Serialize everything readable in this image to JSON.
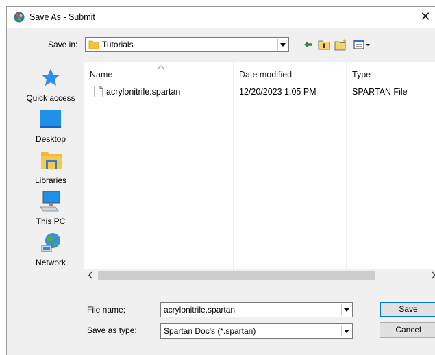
{
  "window": {
    "title": "Save As - Submit",
    "close_symbol": "✕"
  },
  "toolbar": {
    "save_in_label": "Save in:",
    "save_in_value": "Tutorials"
  },
  "places": [
    {
      "label": "Quick access",
      "icon": "quick-access-icon"
    },
    {
      "label": "Desktop",
      "icon": "desktop-icon"
    },
    {
      "label": "Libraries",
      "icon": "libraries-icon"
    },
    {
      "label": "This PC",
      "icon": "this-pc-icon"
    },
    {
      "label": "Network",
      "icon": "network-icon"
    }
  ],
  "filelist": {
    "columns": [
      "Name",
      "Date modified",
      "Type"
    ],
    "rows": [
      {
        "name": "acrylonitrile.spartan",
        "date": "12/20/2023 1:05 PM",
        "type": "SPARTAN File"
      }
    ]
  },
  "form": {
    "filename_label": "File name:",
    "filename_value": "acrylonitrile.spartan",
    "type_label": "Save as type:",
    "type_value": "Spartan Doc's (*.spartan)"
  },
  "buttons": {
    "save": "Save",
    "cancel": "Cancel"
  },
  "colors": {
    "accent": "#0078d7",
    "folder": "#f6c23e",
    "star": "#2e8fe8"
  }
}
